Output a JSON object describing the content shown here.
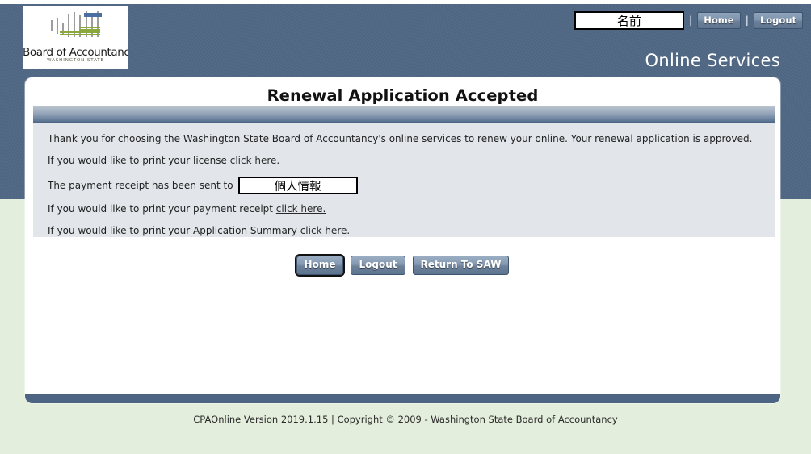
{
  "brand": {
    "logo_title": "Board of Accountancy",
    "logo_subtitle": "WASHINGTON STATE",
    "logo_icon": "abacus-icon",
    "tagline": "Online Services",
    "header_color": "#4d6582",
    "lower_background_color": "#e4eedd"
  },
  "topnav": {
    "name_value": "名前",
    "name_placeholder": "",
    "separator": "|",
    "home_label": "Home",
    "logout_label": "Logout"
  },
  "page": {
    "title": "Renewal Application Accepted"
  },
  "content": {
    "intro": "Thank you for choosing the Washington State Board of Accountancy's online services to renew your online. Your renewal application is approved.",
    "license_line_prefix": "If you would like to print your license ",
    "license_link": "click here.",
    "receipt_sent_prefix": "The payment receipt has been sent to",
    "receipt_email_value": "個人情報",
    "payment_receipt_prefix": "If you would like to print your payment receipt ",
    "payment_receipt_link": "click here.",
    "summary_prefix": "If you would like to print your Application Summary ",
    "summary_link": "click here."
  },
  "buttons": {
    "home": "Home",
    "logout": "Logout",
    "return_to_saw": "Return To SAW"
  },
  "footer": {
    "text": "CPAOnline Version 2019.1.15 | Copyright © 2009 - Washington State Board of Accountancy"
  }
}
